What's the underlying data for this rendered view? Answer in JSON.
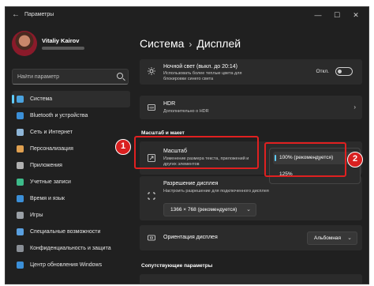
{
  "window": {
    "app_title": "Параметры",
    "controls": [
      "—",
      "☐",
      "✕"
    ]
  },
  "user": {
    "name": "Vitaliy Kairov"
  },
  "search": {
    "placeholder": "Найти параметр"
  },
  "sidebar": {
    "items": [
      {
        "label": "Система",
        "icon": "monitor-icon",
        "color": "#4aa3df",
        "active": true
      },
      {
        "label": "Bluetooth и устройства",
        "icon": "bluetooth-icon",
        "color": "#3b8fd8"
      },
      {
        "label": "Сеть и Интернет",
        "icon": "wifi-icon",
        "color": "#8fb6d8"
      },
      {
        "label": "Персонализация",
        "icon": "brush-icon",
        "color": "#e0a050"
      },
      {
        "label": "Приложения",
        "icon": "apps-icon",
        "color": "#b0b0b0"
      },
      {
        "label": "Учетные записи",
        "icon": "person-icon",
        "color": "#3dbb8a"
      },
      {
        "label": "Время и язык",
        "icon": "globe-clock-icon",
        "color": "#3b8fd8"
      },
      {
        "label": "Игры",
        "icon": "gamepad-icon",
        "color": "#9aa0a6"
      },
      {
        "label": "Специальные возможности",
        "icon": "accessibility-icon",
        "color": "#5aa0e0"
      },
      {
        "label": "Конфиденциальность и защита",
        "icon": "shield-icon",
        "color": "#8a8f96"
      },
      {
        "label": "Центр обновления Windows",
        "icon": "update-icon",
        "color": "#3b8fd8"
      }
    ]
  },
  "breadcrumb": {
    "parent": "Система",
    "separator": "›",
    "current": "Дисплей"
  },
  "night_light": {
    "title": "Ночной свет (выкл. до 20:14)",
    "desc_line1": "Использовать более теплые цвета для",
    "desc_line2": "блокировки синего света",
    "toggle_label": "Откл."
  },
  "hdr": {
    "title": "HDR",
    "desc": "Дополнительно о HDR"
  },
  "scale_section": {
    "title": "Масштаб и макет"
  },
  "scale": {
    "title": "Масштаб",
    "desc_line1": "Изменение размера текста, приложений и",
    "desc_line2": "других элементов",
    "options": [
      "100% (рекомендуется)",
      "125%"
    ],
    "selected": "100% (рекомендуется)"
  },
  "resolution": {
    "title": "Разрешение дисплея",
    "desc": "Настроить разрешение для подключенного дисплея",
    "value": "1366 × 768 (рекомендуется)"
  },
  "orientation": {
    "title": "Ориентация дисплея",
    "value": "Альбомная"
  },
  "related": {
    "title": "Сопутствующие параметры"
  },
  "annotations": {
    "badge1": "1",
    "badge2": "2",
    "color": "#e02020"
  },
  "accent_color": "#60cdff"
}
